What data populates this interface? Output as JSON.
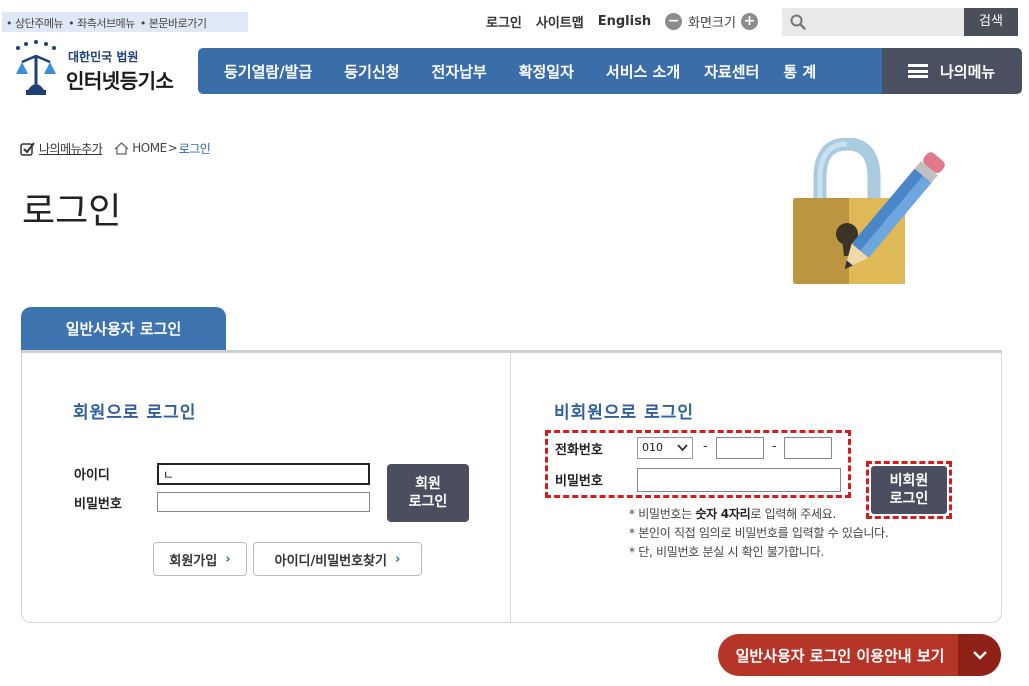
{
  "skipnav": [
    "• 상단주메뉴",
    "• 좌측서브메뉴",
    "• 본문바로가기"
  ],
  "util": {
    "login": "로그인",
    "sitemap": "사이트맵",
    "english": "English",
    "zoom_minus": "−",
    "zoom_label": "화면크기",
    "zoom_plus": "+"
  },
  "search": {
    "placeholder": "",
    "button": "검색"
  },
  "logo": {
    "line1": "대한민국 법원",
    "line2": "인터넷등기소"
  },
  "gnb": [
    "등기열람/발급",
    "등기신청",
    "전자납부",
    "확정일자",
    "서비스 소개",
    "자료센터",
    "통 계"
  ],
  "my_menu": "나의메뉴",
  "breadcrumb": {
    "add": "나의메뉴추가",
    "home": "HOME",
    "sep": ">",
    "current": "로그인"
  },
  "page_title": "로그인",
  "tab": "일반사용자 로그인",
  "member": {
    "heading": "회원으로 로그인",
    "id_label": "아이디",
    "id_value": "ㄴ",
    "pw_label": "비밀번호",
    "pw_value": "",
    "login_line1": "회원",
    "login_line2": "로그인",
    "join": "회원가입",
    "find": "아이디/비밀번호찾기",
    "chevron": "›"
  },
  "nonmember": {
    "heading": "비회원으로 로그인",
    "phone_label": "전화번호",
    "phone_prefix": "010",
    "phone_mid": "",
    "phone_last": "",
    "dash": "-",
    "pw_label": "비밀번호",
    "pw_value": "",
    "login_line1": "비회원",
    "login_line2": "로그인",
    "note1_pre": "* 비밀번호는 ",
    "note1_bold": "숫자 4자리",
    "note1_post": "로 입력해 주세요.",
    "note2": "* 본인이 직접 임의로 비밀번호를 입력할 수 있습니다.",
    "note3": "* 단, 비밀번호 분실 시 확인 불가합니다."
  },
  "guide_button": "일반사용자 로그인 이용안내 보기",
  "colors": {
    "nav": "#3b6ea8",
    "mymenu": "#4b5061",
    "highlight": "#d51b1b",
    "guide": "#b53529"
  }
}
